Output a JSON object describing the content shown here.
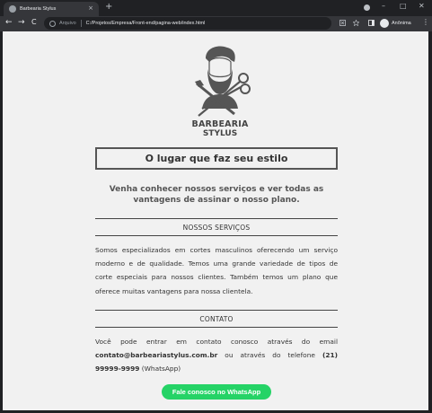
{
  "browser": {
    "tab_title": "Barbearia Stylus",
    "new_tab": "+",
    "tab_close": "×",
    "minimize": "–",
    "maximize": "□",
    "close_window": "✕",
    "back": "←",
    "forward": "→",
    "reload": "C",
    "site_label": "Arquivo",
    "url": "C:/Projetos/Empresa/Front-end/pagina-web/index.html",
    "profile_name": "Anônima",
    "menu": "⋮"
  },
  "page": {
    "logo": {
      "line1": "BARBEARIA",
      "line2": "STYLUS"
    },
    "headline": "O lugar que faz seu estilo",
    "subtitle": "Venha conhecer nossos serviços e ver todas as vantagens de assinar o nosso plano.",
    "services": {
      "title": "NOSSOS SERVIÇOS",
      "text": "Somos especializados em cortes masculinos oferecendo um serviço moderno e de qualidade. Temos uma grande variedade de tipos de corte especiais para nossos clientes. Também temos um plano que oferece muitas vantagens para nossa clientela."
    },
    "contact": {
      "title": "CONTATO",
      "text_start": "Você pode entrar em contato conosco através do email ",
      "email": "contato@barbeariastylus.com.br",
      "text_mid": " ou através do telefone ",
      "phone": "(21) 99999-9999",
      "text_end": " (WhatsApp)"
    },
    "whatsapp_button": "Fale conosco no WhatsApp"
  },
  "colors": {
    "page_bg": "#f1f1f1",
    "text": "#333333",
    "whatsapp": "#25d366",
    "chrome_dark": "#202124",
    "chrome_toolbar": "#35363a"
  }
}
